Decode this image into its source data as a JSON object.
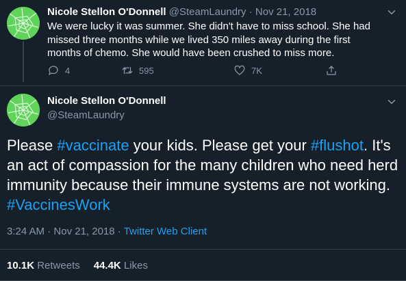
{
  "reply": {
    "display_name": "Nicole Stellon O'Donnell",
    "handle": "@SteamLaundry",
    "separator": "·",
    "date": "Nov 21, 2018",
    "text": "We were lucky it was summer. She didn't have to miss school. She had missed three months while we lived 350 miles away during the first months of chemo. She would have been crushed to miss more.",
    "actions": {
      "reply_count": "4",
      "retweet_count": "595",
      "like_count": "7K"
    }
  },
  "main": {
    "display_name": "Nicole Stellon O'Donnell",
    "handle": "@SteamLaundry",
    "text_parts": {
      "t1": "Please ",
      "h1": "#vaccinate",
      "t2": " your kids. Please get your ",
      "h2": "#flushot",
      "t3": ". It's an act of compassion for the many children who need herd immunity because their immune systems are not working. ",
      "h3": "#VaccinesWork"
    },
    "time": "3:24 AM",
    "separator": "·",
    "date": "Nov 21, 2018",
    "separator2": "·",
    "client": "Twitter Web Client",
    "retweets_count": "10.1K",
    "retweets_label": "Retweets",
    "likes_count": "44.4K",
    "likes_label": "Likes"
  },
  "colors": {
    "background": "#15202b",
    "text": "#ffffff",
    "muted": "#8899a6",
    "link": "#1da1f2",
    "divider": "#38444d",
    "avatar": "#5fd35a"
  }
}
